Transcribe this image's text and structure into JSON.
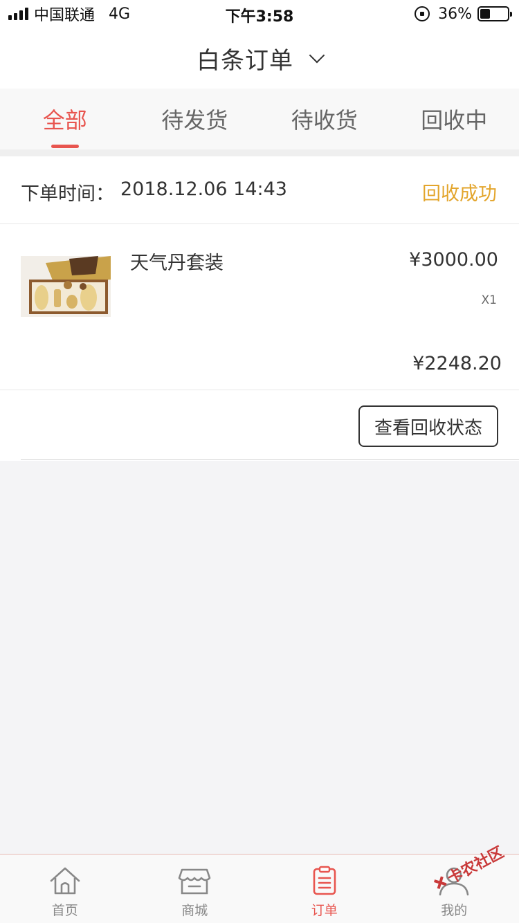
{
  "status_bar": {
    "carrier": "中国联通",
    "network": "4G",
    "time": "下午3:58",
    "battery_percent": "36%",
    "battery_level": 0.36
  },
  "header": {
    "title": "白条订单"
  },
  "tabs": [
    {
      "label": "全部",
      "active": true
    },
    {
      "label": "待发货",
      "active": false
    },
    {
      "label": "待收货",
      "active": false
    },
    {
      "label": "回收中",
      "active": false
    }
  ],
  "order": {
    "time_label": "下单时间：",
    "time_value": "2018.12.06 14:43",
    "status": "回收成功",
    "product_name": "天气丹套装",
    "unit_price": "¥3000.00",
    "quantity": "X1",
    "total": "¥2248.20",
    "action_label": "查看回收状态"
  },
  "tabbar": [
    {
      "label": "首页",
      "icon": "home-icon",
      "active": false
    },
    {
      "label": "商城",
      "icon": "store-icon",
      "active": false
    },
    {
      "label": "订单",
      "icon": "order-icon",
      "active": true
    },
    {
      "label": "我的",
      "icon": "profile-icon",
      "active": false
    }
  ],
  "watermark": "卡农社区",
  "colors": {
    "accent": "#e8554f",
    "status": "#e3a52c"
  }
}
